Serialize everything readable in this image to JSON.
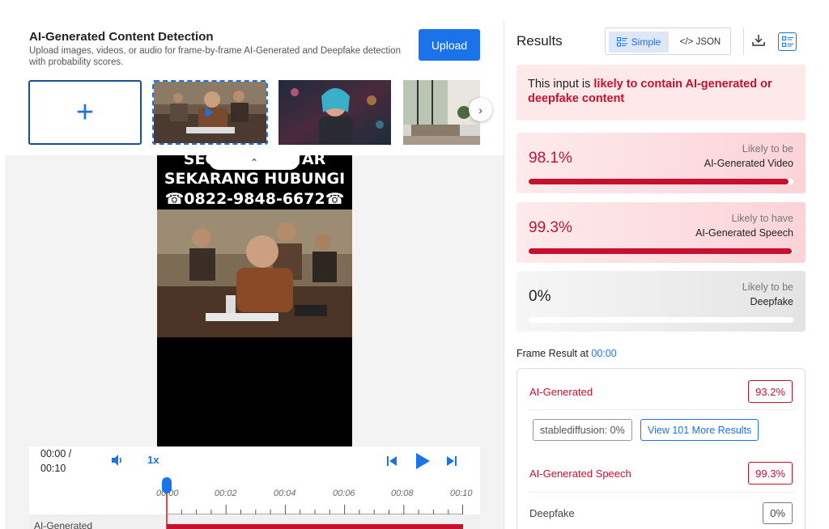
{
  "app": {
    "title": "AI-Generated Content Detection",
    "description": "Upload images, videos, or audio for frame-by-frame AI-Generated and Deepfake detection with probability scores.",
    "upload_label": "Upload"
  },
  "gallery": {
    "add_symbol": "+",
    "next_symbol": "›"
  },
  "video": {
    "caption_line1": "SEGERA DAFTAR",
    "caption_line2": "SEKARANG HUBUNGI",
    "caption_line3": "☎0822-9848-6672☎",
    "collapse_symbol": "⌃"
  },
  "player": {
    "current_time": "00:00 /",
    "duration": "00:10",
    "speed": "1x"
  },
  "timeline": {
    "ticks": [
      "00:00",
      "00:02",
      "00:04",
      "00:06",
      "00:08",
      "00:10"
    ],
    "track_label": "AI-Generated"
  },
  "results": {
    "title": "Results",
    "view_simple": "Simple",
    "view_json": "</> JSON",
    "verdict_prefix": "This input is ",
    "verdict_highlight": "likely to contain AI-generated or deepfake content",
    "cards": [
      {
        "percent_text": "98.1%",
        "value": 98.1,
        "sub": "Likely to be",
        "main": "AI-Generated Video",
        "status": "red"
      },
      {
        "percent_text": "99.3%",
        "value": 99.3,
        "sub": "Likely to have",
        "main": "AI-Generated Speech",
        "status": "red"
      },
      {
        "percent_text": "0%",
        "value": 0,
        "sub": "Likely to be",
        "main": "Deepfake",
        "status": "grey"
      }
    ],
    "frame_result_label": "Frame Result at ",
    "frame_result_time": "00:00",
    "frame": {
      "ai_generated_label": "AI-Generated",
      "ai_generated_value": "93.2%",
      "chip_label": "stablediffusion: 0%",
      "more_label": "View 101 More Results",
      "speech_label": "AI-Generated Speech",
      "speech_value": "99.3%",
      "deepfake_label": "Deepfake",
      "deepfake_value": "0%"
    }
  },
  "colors": {
    "accent": "#1a73e8",
    "alert": "#c8102e",
    "alert_bg": "#fde8ea"
  }
}
